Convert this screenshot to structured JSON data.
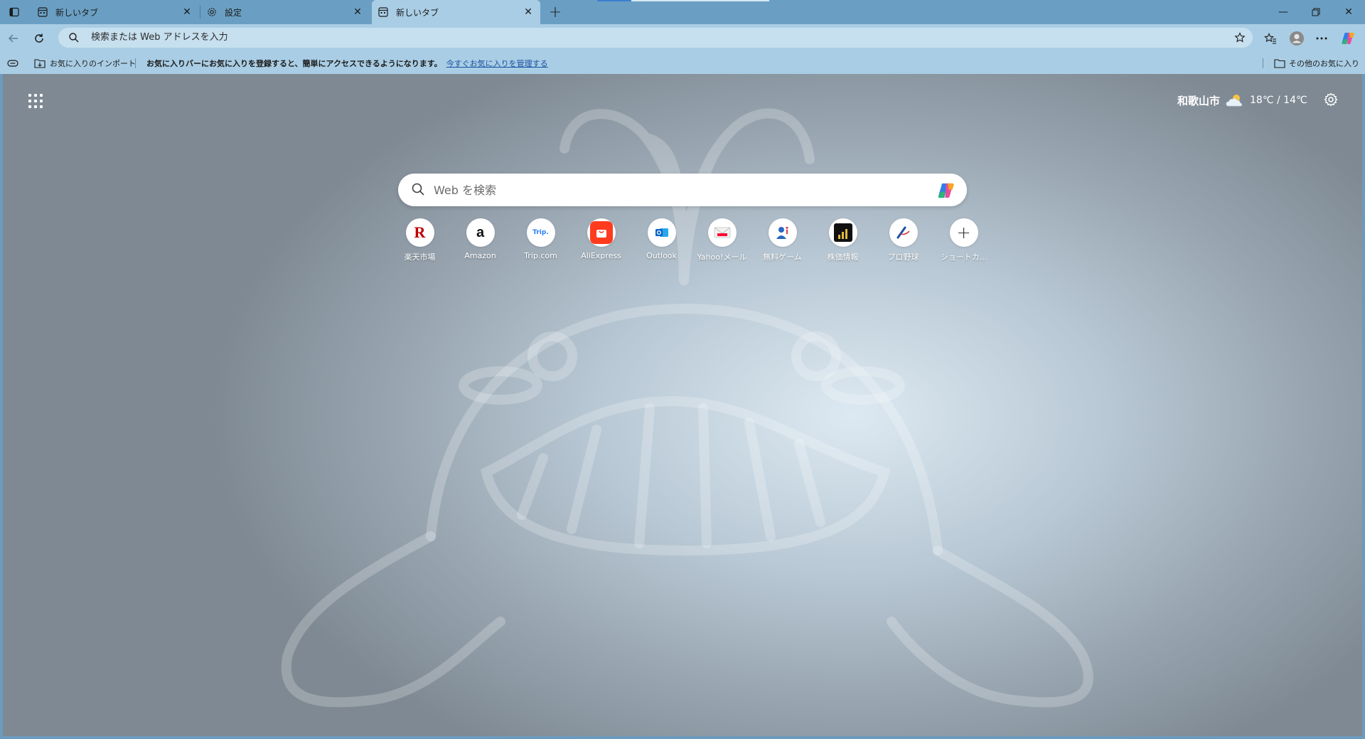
{
  "tabs": [
    {
      "title": "新しいタブ",
      "icon": "newtab-icon",
      "active": false
    },
    {
      "title": "設定",
      "icon": "gear-icon",
      "active": false
    },
    {
      "title": "新しいタブ",
      "icon": "newtab-icon",
      "active": true
    }
  ],
  "address_bar": {
    "placeholder": "検索または Web アドレスを入力"
  },
  "bookmarks_bar": {
    "import_label": "お気に入りのインポート",
    "message": "お気に入りバーにお気に入りを登録すると、簡単にアクセスできるようになります。",
    "manage_link": "今すぐお気に入りを管理する",
    "other_favorites": "その他のお気に入り"
  },
  "weather": {
    "city": "和歌山市",
    "temperature": "18℃ / 14℃",
    "condition_icon": "partly-cloudy-icon"
  },
  "search": {
    "placeholder": "Web を検索"
  },
  "shortcuts": [
    {
      "label": "楽天市場",
      "icon": "rakuten-icon"
    },
    {
      "label": "Amazon",
      "icon": "amazon-icon"
    },
    {
      "label": "Trip.com",
      "icon": "trip-icon"
    },
    {
      "label": "AliExpress",
      "icon": "aliexpress-icon"
    },
    {
      "label": "Outlook",
      "icon": "outlook-icon"
    },
    {
      "label": "Yahoo!メール",
      "icon": "yahoo-mail-icon"
    },
    {
      "label": "無料ゲーム",
      "icon": "games-icon"
    },
    {
      "label": "株価情報",
      "icon": "stocks-icon"
    },
    {
      "label": "プロ野球",
      "icon": "baseball-icon"
    },
    {
      "label": "ショートカ...",
      "icon": "add-shortcut-icon"
    }
  ],
  "colors": {
    "accent": "#1a73e8",
    "tab_bar": "#6a9fc3",
    "toolbar": "#a9cde4"
  }
}
